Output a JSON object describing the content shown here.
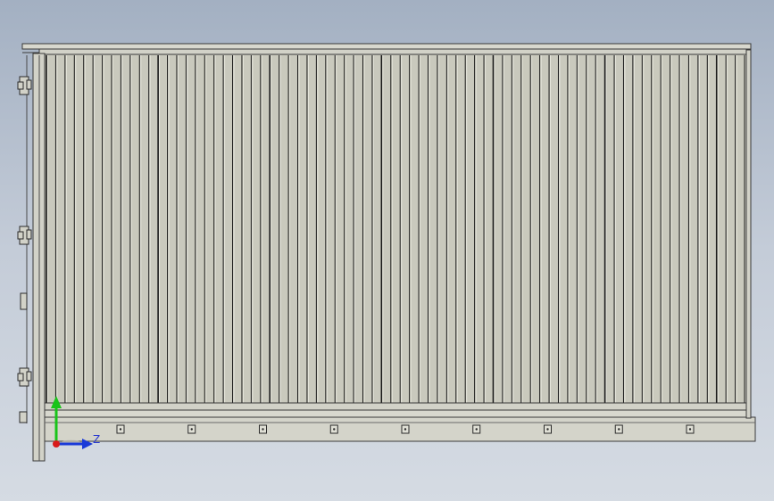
{
  "viewport": {
    "background_top": "#a3b0c2",
    "background_bottom": "#d5dbe3",
    "model": {
      "panel_fill": "#c9c9bd",
      "slat_dark": "#1a1a1a",
      "slat_light": "#e6e6dc",
      "frame_stroke": "#3a3a3a",
      "frame_fill": "#d2d2c8",
      "slat_count": 75,
      "bolt_count": 9
    }
  },
  "triad": {
    "z_label": "Z",
    "y_color": "#19c419",
    "z_color": "#1a3ad8",
    "origin_color": "#d81a1a",
    "icons": [
      "y-axis-arrow-icon",
      "z-axis-arrow-icon",
      "origin-point-icon"
    ]
  }
}
